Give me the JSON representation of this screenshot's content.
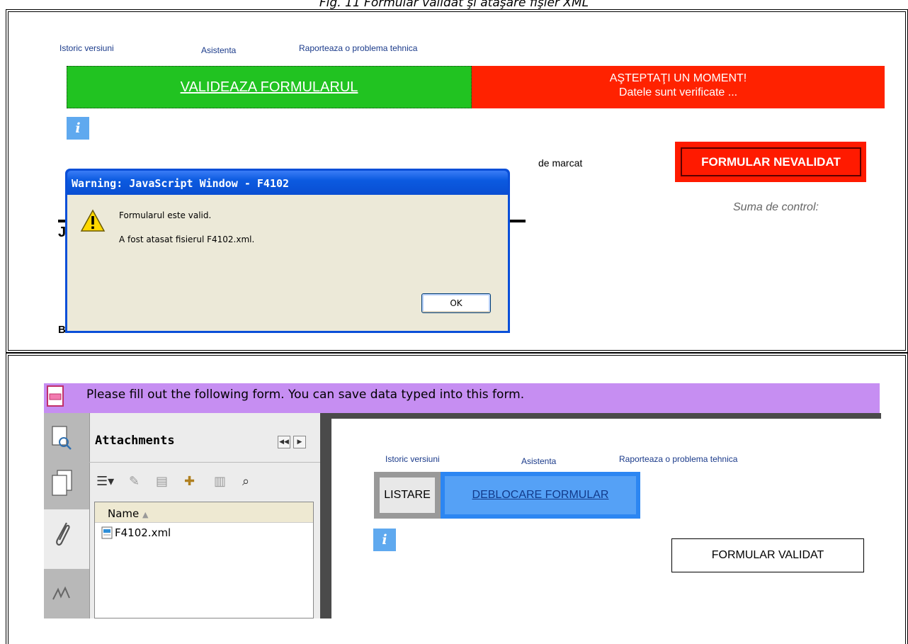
{
  "caption": "Fig. 11 Formular validat şi ataşare fişier XML",
  "top_panel": {
    "links": [
      "Istoric versiuni",
      "Asistenta",
      "Raporteaza o problema tehnica"
    ],
    "validate_label": "VALIDEAZA FORMULARUL",
    "wait_line1": "AŞTEPTAŢI UN MOMENT!",
    "wait_line2": "Datele sunt verificate ...",
    "info_glyph": "i",
    "de_marcat": "de marcat",
    "nevalidat_label": "FORMULAR NEVALIDAT",
    "suma_label": "Suma de control:"
  },
  "dialog": {
    "title": "Warning: JavaScript Window - F4102",
    "line1": "Formularul este valid.",
    "line2": "A fost atasat fisierul F4102.xml.",
    "ok_label": "OK"
  },
  "bottom_panel": {
    "banner_text": "Please fill out the following form. You can save data typed into this form.",
    "attachments_title": "Attachments",
    "name_column": "Name",
    "file_name": "F4102.xml",
    "links": [
      "Istoric versiuni",
      "Asistenta",
      "Raporteaza o problema tehnica"
    ],
    "listare_label": "LISTARE",
    "deblocare_label": "DEBLOCARE FORMULAR",
    "info_glyph": "i",
    "validat_label": "FORMULAR VALIDAT"
  },
  "colors": {
    "validate_green": "#21c321",
    "wait_red": "#ff2200",
    "info_blue": "#5fa9ef",
    "banner_purple": "#c68ef2",
    "button_blue": "#2c86f2"
  }
}
